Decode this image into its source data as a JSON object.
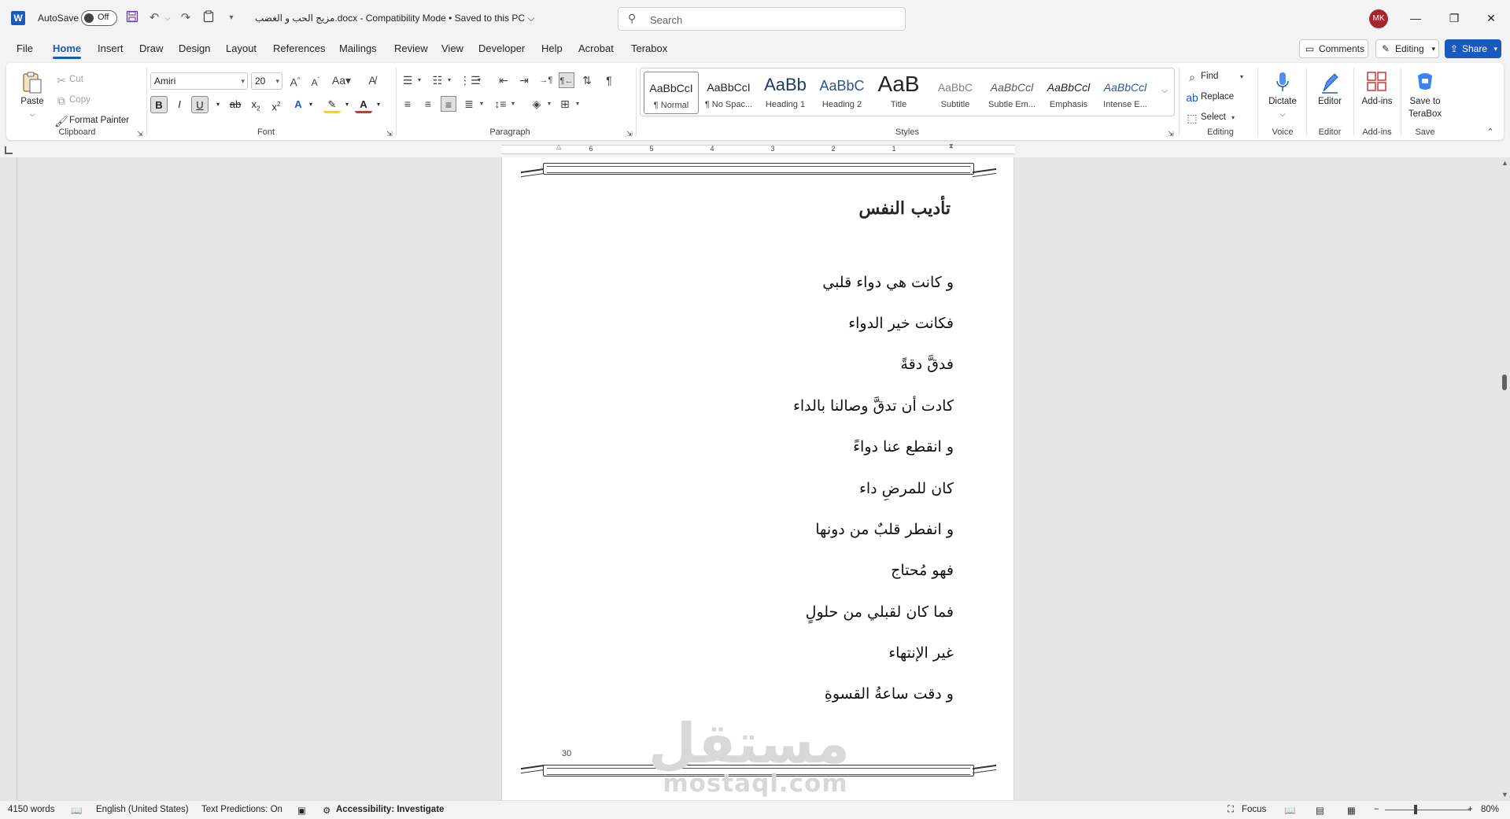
{
  "titlebar": {
    "autosave_label": "AutoSave",
    "autosave_state": "Off",
    "doc_title": "مزيج الحب و الغضب.docx  -  Compatibility Mode  •  Saved to this PC ⌵",
    "search_placeholder": "Search",
    "avatar_initials": "MK"
  },
  "menu": {
    "tabs": [
      "File",
      "Home",
      "Insert",
      "Draw",
      "Design",
      "Layout",
      "References",
      "Mailings",
      "Review",
      "View",
      "Developer",
      "Help",
      "Acrobat",
      "Terabox"
    ],
    "active_tab": "Home",
    "comments_label": "Comments",
    "editing_label": "Editing",
    "share_label": "Share"
  },
  "ribbon": {
    "clipboard": {
      "paste_label": "Paste",
      "cut_label": "Cut",
      "copy_label": "Copy",
      "format_painter_label": "Format Painter",
      "group_label": "Clipboard"
    },
    "font": {
      "font_name": "Amiri",
      "font_size": "20",
      "group_label": "Font"
    },
    "paragraph": {
      "group_label": "Paragraph"
    },
    "styles": {
      "group_label": "Styles",
      "items": [
        {
          "preview": "AaBbCcI",
          "name": "¶ Normal"
        },
        {
          "preview": "AaBbCcI",
          "name": "¶ No Spac..."
        },
        {
          "preview": "AaBb",
          "name": "Heading 1"
        },
        {
          "preview": "AaBbC",
          "name": "Heading 2"
        },
        {
          "preview": "AaB",
          "name": "Title"
        },
        {
          "preview": "AaBbC",
          "name": "Subtitle"
        },
        {
          "preview": "AaBbCcl",
          "name": "Subtle Em..."
        },
        {
          "preview": "AaBbCcl",
          "name": "Emphasis"
        },
        {
          "preview": "AaBbCcl",
          "name": "Intense E..."
        }
      ]
    },
    "editing": {
      "find_label": "Find",
      "replace_label": "Replace",
      "select_label": "Select",
      "group_label": "Editing"
    },
    "voice": {
      "dictate_label": "Dictate",
      "group_label": "Voice"
    },
    "editor": {
      "editor_label": "Editor",
      "group_label": "Editor"
    },
    "addins": {
      "addins_label": "Add-ins",
      "group_label": "Add-ins"
    },
    "save": {
      "save_label_1": "Save to",
      "save_label_2": "TeraBox",
      "group_label": "Save"
    }
  },
  "ruler_numbers": [
    "6",
    "5",
    "4",
    "3",
    "2",
    "1"
  ],
  "document": {
    "heading": "تأديب النفس",
    "lines": [
      "و كانت هي دواء قلبي",
      "فكانت خير الدواء",
      "فدقَّ دقةً",
      "كادت أن تدقَّ وصالنا بالداء",
      "و انقطع عنا دواءً",
      "كان للمرضِ داء",
      "و انفطر قلبٌ من دونها",
      "فهو مُحتاج",
      "فما كان لقبلي من حلولٍ",
      "غير الإنتهاء",
      "و دقت ساعةُ القسوةِ"
    ],
    "page_number": "30"
  },
  "watermark": {
    "arabic": "مستقل",
    "latin": "mostaql.com"
  },
  "statusbar": {
    "words": "4150 words",
    "language": "English (United States)",
    "text_predictions": "Text Predictions: On",
    "accessibility": "Accessibility: Investigate",
    "focus": "Focus",
    "zoom": "80%"
  },
  "colors": {
    "accent": "#185abd",
    "avatar": "#a4262c"
  }
}
